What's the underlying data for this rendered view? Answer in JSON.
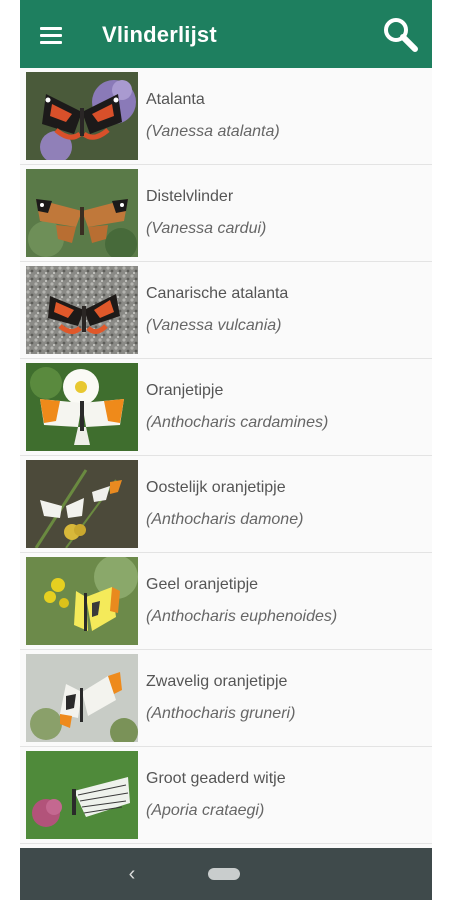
{
  "app": {
    "title": "Vlinderlijst",
    "accent_color": "#1e7f5f",
    "menu_icon": "menu-icon",
    "search_icon": "search-icon"
  },
  "species": [
    {
      "common": "Atalanta",
      "scientific": "(Vanessa atalanta)"
    },
    {
      "common": "Distelvlinder",
      "scientific": "(Vanessa cardui)"
    },
    {
      "common": "Canarische atalanta",
      "scientific": "(Vanessa vulcania)"
    },
    {
      "common": "Oranjetipje",
      "scientific": "(Anthocharis cardamines)"
    },
    {
      "common": "Oostelijk oranjetipje",
      "scientific": "(Anthocharis damone)"
    },
    {
      "common": "Geel oranjetipje",
      "scientific": "(Anthocharis euphenoides)"
    },
    {
      "common": "Zwavelig oranjetipje",
      "scientific": "(Anthocharis gruneri)"
    },
    {
      "common": "Groot geaderd witje",
      "scientific": "(Aporia crataegi)"
    }
  ],
  "navigation": {
    "back_icon": "back-icon",
    "home_icon": "home-pill-icon",
    "back_glyph": "‹"
  }
}
